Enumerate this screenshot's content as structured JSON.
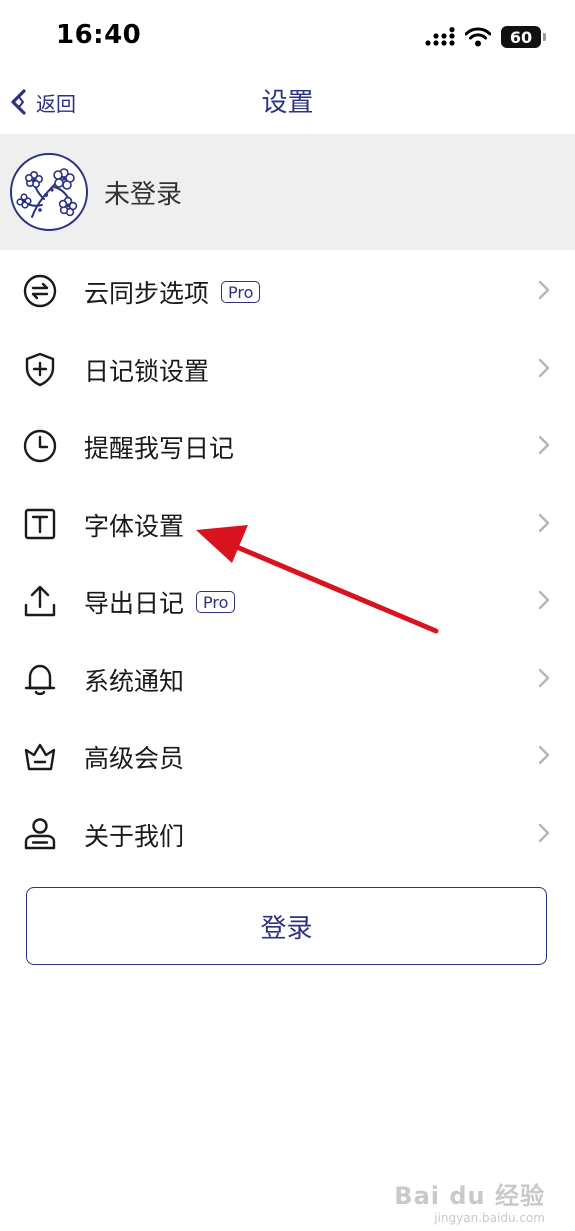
{
  "status_bar": {
    "time": "16:40",
    "battery": "60"
  },
  "nav": {
    "back_label": "返回",
    "title": "设置"
  },
  "profile": {
    "name": "未登录"
  },
  "menu": [
    {
      "label": "云同步选项",
      "icon": "sync-icon",
      "badge": "Pro"
    },
    {
      "label": "日记锁设置",
      "icon": "shield-plus-icon"
    },
    {
      "label": "提醒我写日记",
      "icon": "clock-icon"
    },
    {
      "label": "字体设置",
      "icon": "text-t-icon"
    },
    {
      "label": "导出日记",
      "icon": "upload-icon",
      "badge": "Pro"
    },
    {
      "label": "系统通知",
      "icon": "bell-icon"
    },
    {
      "label": "高级会员",
      "icon": "crown-icon"
    },
    {
      "label": "关于我们",
      "icon": "person-icon"
    }
  ],
  "login_button": {
    "label": "登录"
  },
  "watermark": {
    "brand": "Bai du 经验",
    "url": "jingyan.baidu.com"
  },
  "colors": {
    "accent": "#2d3280",
    "arrow": "#d8121e",
    "profile_bg": "#efeff0"
  }
}
